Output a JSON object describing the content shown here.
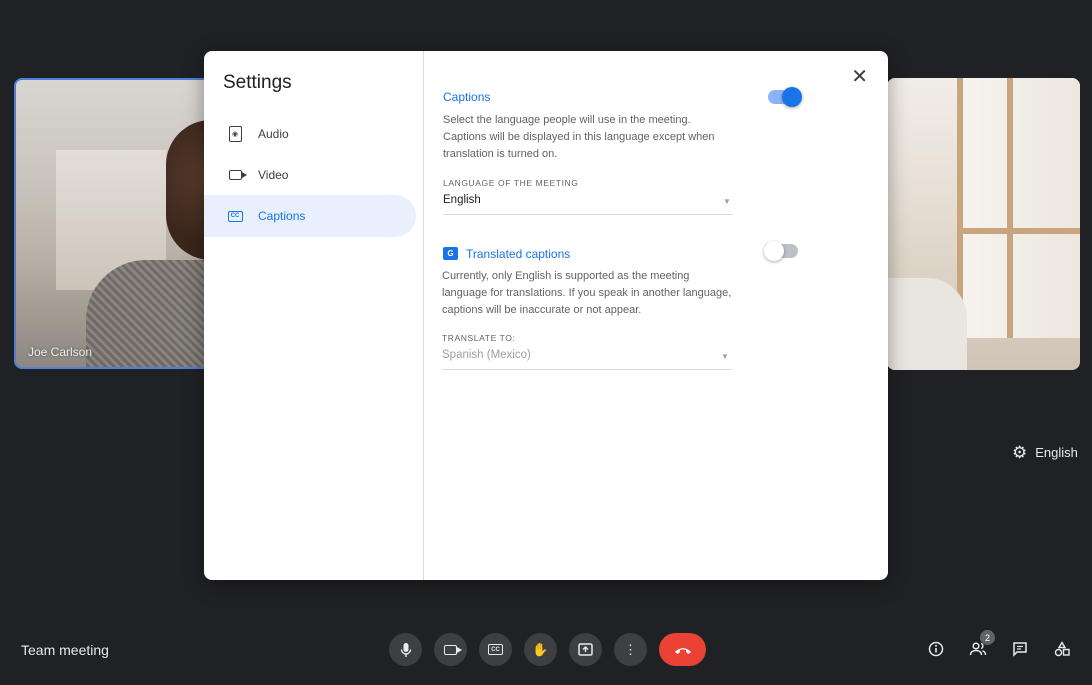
{
  "participants": {
    "left_name": "Joe Carlson"
  },
  "language_chip": {
    "label": "English"
  },
  "bottombar": {
    "meeting_title": "Team meeting",
    "people_count": "2"
  },
  "settings": {
    "title": "Settings",
    "nav": [
      {
        "label": "Audio",
        "icon": "speaker-icon"
      },
      {
        "label": "Video",
        "icon": "video-camera-icon"
      },
      {
        "label": "Captions",
        "icon": "closed-captions-icon",
        "selected": true
      }
    ],
    "captions": {
      "title": "Captions",
      "enabled": true,
      "description": "Select the language people will use in the meeting. Captions will be displayed in this language except when translation is turned on.",
      "language_label": "LANGUAGE OF THE MEETING",
      "language_value": "English"
    },
    "translated": {
      "title": "Translated captions",
      "enabled": false,
      "description": "Currently, only English is supported as the meeting language for translations. If you speak in another language, captions will be inaccurate or not appear.",
      "translate_label": "TRANSLATE TO:",
      "translate_value": "Spanish (Mexico)"
    }
  },
  "colors": {
    "accent": "#1a73e8",
    "end_call": "#ea4335",
    "background": "#202124"
  }
}
